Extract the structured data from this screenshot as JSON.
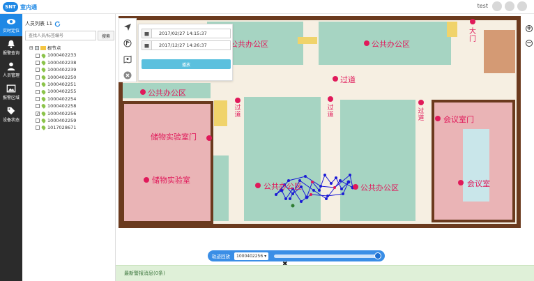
{
  "header": {
    "logo_badge": "SNT",
    "logo_text": "室内通",
    "user": "test"
  },
  "nav": {
    "items": [
      {
        "label": "实时定位",
        "icon": "eye-icon",
        "active": true
      },
      {
        "label": "报警查询",
        "icon": "bell-icon"
      },
      {
        "label": "人员管理",
        "icon": "user-icon"
      },
      {
        "label": "报警区域",
        "icon": "picture-icon"
      },
      {
        "label": "设备状态",
        "icon": "tag-icon"
      }
    ]
  },
  "panel": {
    "title": "人员列表 11",
    "search_placeholder": "查找人员/标签编号",
    "search_button": "搜索",
    "root": "根节点",
    "tags": [
      "1000402233",
      "1000402238",
      "1000402239",
      "1000402250",
      "1000402251",
      "1000402255",
      "1000402254",
      "1000402258",
      "1000402256",
      "1000402259",
      "1017028671"
    ],
    "checked_tag_index": 8
  },
  "history": {
    "start_time": "2017/02/27 14:15:37",
    "end_time": "2017/12/27 14:26:37",
    "play_button": "播放"
  },
  "map": {
    "labels": {
      "office_top_left": "公共办公区",
      "office_top_right": "公共办公区",
      "aisle_center": "过道",
      "office_left": "公共办公区",
      "aisle_v1": "过道",
      "aisle_v2": "过道",
      "aisle_v3": "过道",
      "meeting_door": "会议室门",
      "storage_door": "储物实验室门",
      "storage_room": "储物实验室",
      "office_mid_left": "公共办公区",
      "office_mid_right": "公共办公区",
      "meeting_room": "会议室",
      "gate": "大门"
    },
    "colors": {
      "wall": "#6b3a1e",
      "floor": "#f6efe2",
      "office": "#a6d4c2",
      "storage": "#eab4b6",
      "marker": "#e0195a",
      "track": "#1a1ad6"
    }
  },
  "player": {
    "label": "轨迹回放",
    "selected_tag": "1000402256 ▾"
  },
  "alarm": {
    "text": "最新警报消息(0条)"
  }
}
